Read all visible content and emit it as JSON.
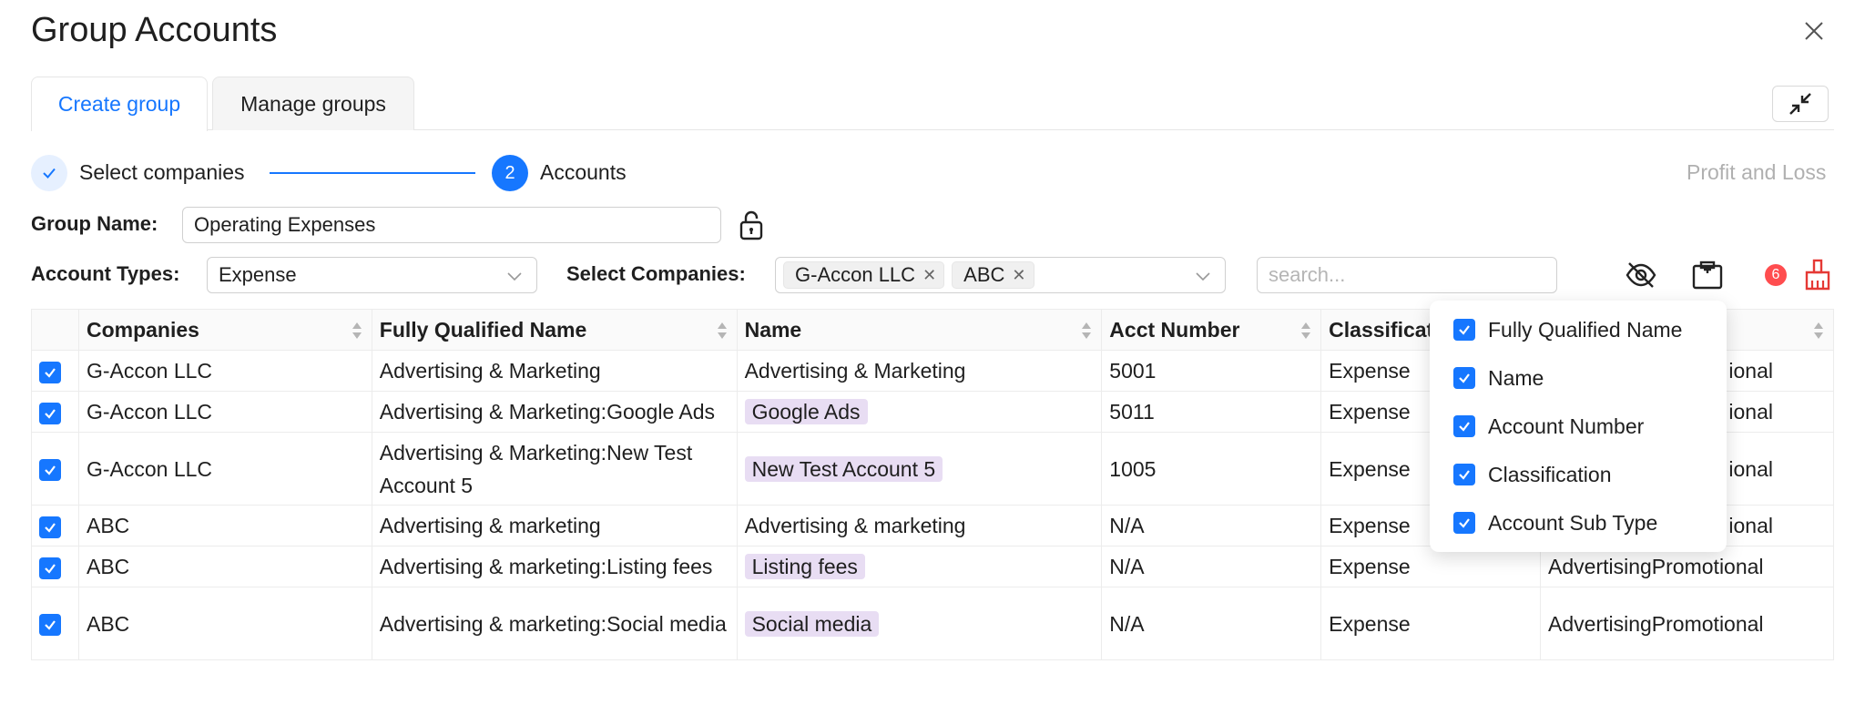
{
  "header": {
    "title": "Group Accounts",
    "close_icon": "close-icon"
  },
  "tabs": [
    {
      "label": "Create group",
      "active": true
    },
    {
      "label": "Manage groups",
      "active": false
    }
  ],
  "steps": {
    "step1_label": "Select companies",
    "step1_icon": "check-icon",
    "step2_number": "2",
    "step2_label": "Accounts",
    "report_label": "Profit and Loss"
  },
  "form": {
    "group_name_label": "Group Name:",
    "group_name_value": "Operating Expenses",
    "account_types_label": "Account Types:",
    "account_types_value": "Expense",
    "select_companies_label": "Select Companies:",
    "companies": [
      "G-Accon LLC",
      "ABC"
    ],
    "search_placeholder": "search..."
  },
  "toolbar": {
    "badge_count": "6",
    "icons": [
      "eye-off-icon",
      "columns-icon",
      "broom-icon"
    ]
  },
  "colors": {
    "accent": "#1677ff",
    "badge": "#ff4d4f",
    "highlight": "#e8ddf3",
    "broom": "#e53935"
  },
  "table": {
    "columns": [
      "Companies",
      "Fully Qualified Name",
      "Name",
      "Acct Number",
      "Classificat",
      ""
    ],
    "rows": [
      {
        "company": "G-Accon LLC",
        "fqn": "Advertising & Marketing",
        "name": "Advertising & Marketing",
        "name_highlight": false,
        "acct": "5001",
        "classification": "Expense",
        "subtype": "ional"
      },
      {
        "company": "G-Accon LLC",
        "fqn": "Advertising & Marketing:Google Ads",
        "name": "Google Ads",
        "name_highlight": true,
        "acct": "5011",
        "classification": "Expense",
        "subtype": "ional"
      },
      {
        "company": "G-Accon LLC",
        "fqn": "Advertising & Marketing:New Test Account 5",
        "name": "New Test Account 5",
        "name_highlight": true,
        "acct": "1005",
        "classification": "Expense",
        "subtype": "ional"
      },
      {
        "company": "ABC",
        "fqn": "Advertising & marketing",
        "name": "Advertising & marketing",
        "name_highlight": false,
        "acct": "N/A",
        "classification": "Expense",
        "subtype": "ional"
      },
      {
        "company": "ABC",
        "fqn": "Advertising & marketing:Listing fees",
        "name": "Listing fees",
        "name_highlight": true,
        "acct": "N/A",
        "classification": "Expense",
        "subtype": "AdvertisingPromotional"
      },
      {
        "company": "ABC",
        "fqn": "Advertising & marketing:Social media",
        "name": "Social media",
        "name_highlight": true,
        "acct": "N/A",
        "classification": "Expense",
        "subtype": "AdvertisingPromotional"
      }
    ]
  },
  "column_menu": {
    "items": [
      {
        "label": "Fully Qualified Name",
        "checked": true
      },
      {
        "label": "Name",
        "checked": true
      },
      {
        "label": "Account Number",
        "checked": true
      },
      {
        "label": "Classification",
        "checked": true
      },
      {
        "label": "Account Sub Type",
        "checked": true
      }
    ]
  }
}
